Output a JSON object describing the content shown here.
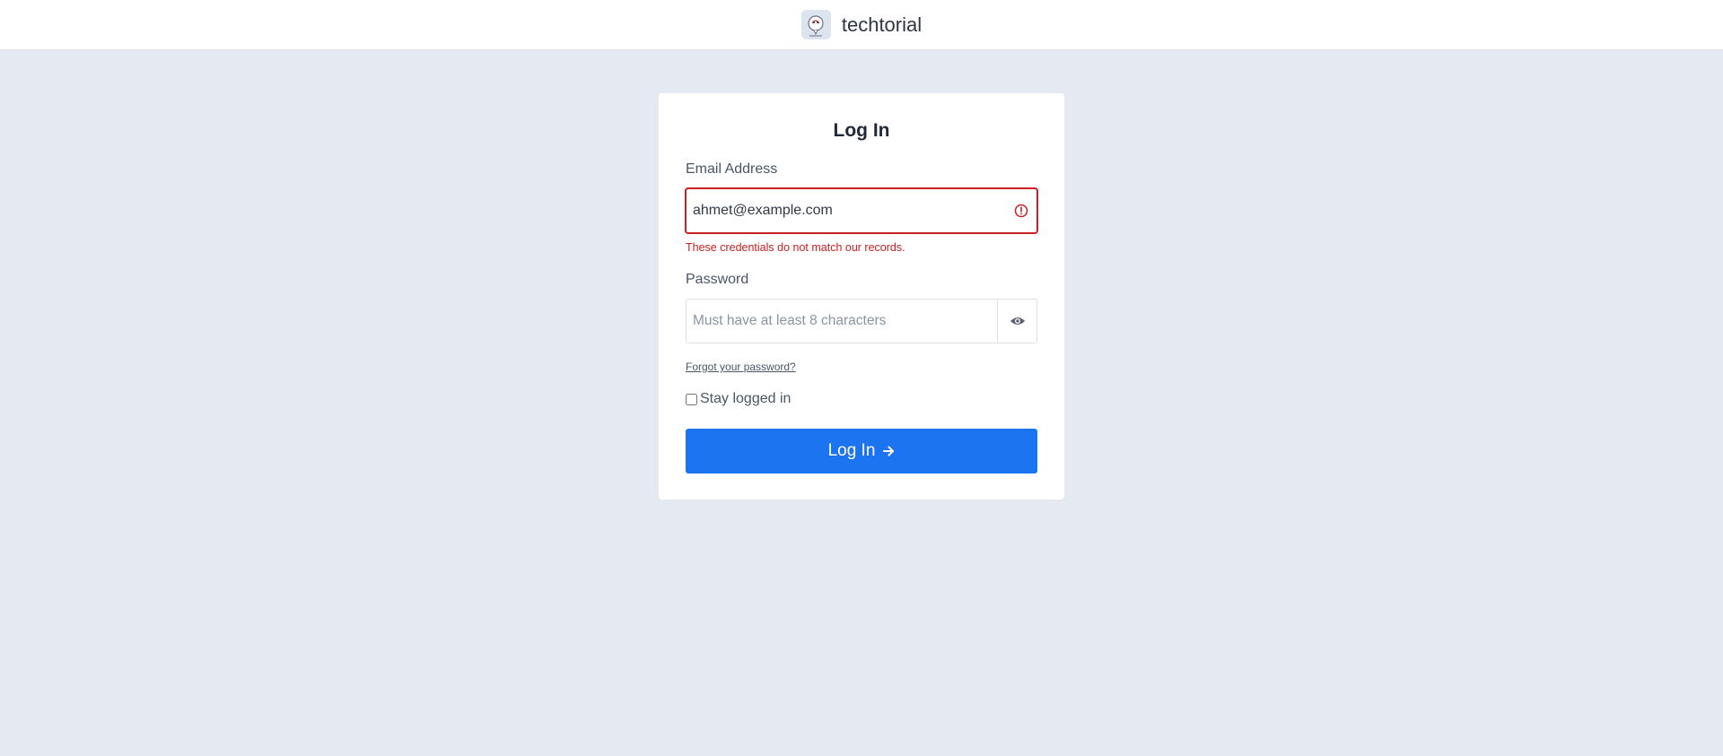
{
  "header": {
    "brand": "techtorial",
    "logo_icon": "chat-bubble-mascot-icon"
  },
  "form": {
    "title": "Log In",
    "email": {
      "label": "Email Address",
      "value": "ahmet@example.com",
      "error": "These credentials do not match our records.",
      "error_icon": "alert-circle-icon"
    },
    "password": {
      "label": "Password",
      "placeholder": "Must have at least 8 characters",
      "value": "",
      "toggle_icon": "eye-icon"
    },
    "forgot_link": "Forgot your password?",
    "remember": {
      "label": "Stay logged in",
      "checked": false
    },
    "submit": {
      "label": "Log In",
      "icon": "arrow-right-icon"
    }
  },
  "colors": {
    "background": "#e4e9f2",
    "accent": "#1d74f0",
    "error": "#cc1f1f"
  }
}
